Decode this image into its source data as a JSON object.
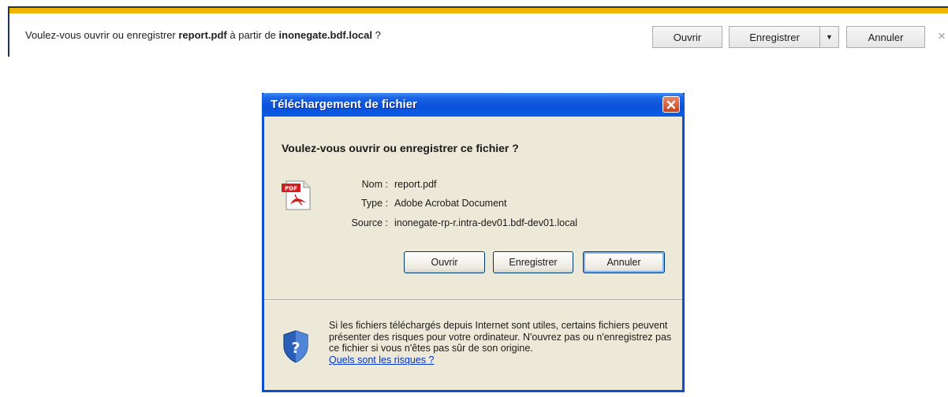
{
  "notification_bar": {
    "message_prefix": "Voulez-vous ouvrir ou enregistrer ",
    "file_name": "report.pdf",
    "message_middle": " à partir de ",
    "host": "inonegate.bdf.local",
    "message_suffix": " ?",
    "open_label": "Ouvrir",
    "save_label": "Enregistrer",
    "cancel_label": "Annuler",
    "accent_color": "#f1b400"
  },
  "dialog": {
    "title": "Téléchargement de fichier",
    "question": "Voulez-vous ouvrir ou enregistrer ce fichier ?",
    "name_label": "Nom :",
    "name_value": "report.pdf",
    "type_label": "Type :",
    "type_value": "Adobe Acrobat Document",
    "source_label": "Source :",
    "source_value": "inonegate-rp-r.intra-dev01.bdf-dev01.local",
    "open_label": "Ouvrir",
    "save_label": "Enregistrer",
    "cancel_label": "Annuler",
    "warning_text": "Si les fichiers téléchargés depuis Internet sont utiles, certains fichiers peuvent présenter des risques pour votre ordinateur. N'ouvrez pas ou n'enregistrez pas ce fichier si vous n'êtes pas sûr de son origine.",
    "risks_link": "Quels sont les risques ?",
    "icons": {
      "file": "pdf-file-icon",
      "security": "shield-icon"
    },
    "title_bar_color": "#0a50d8"
  }
}
